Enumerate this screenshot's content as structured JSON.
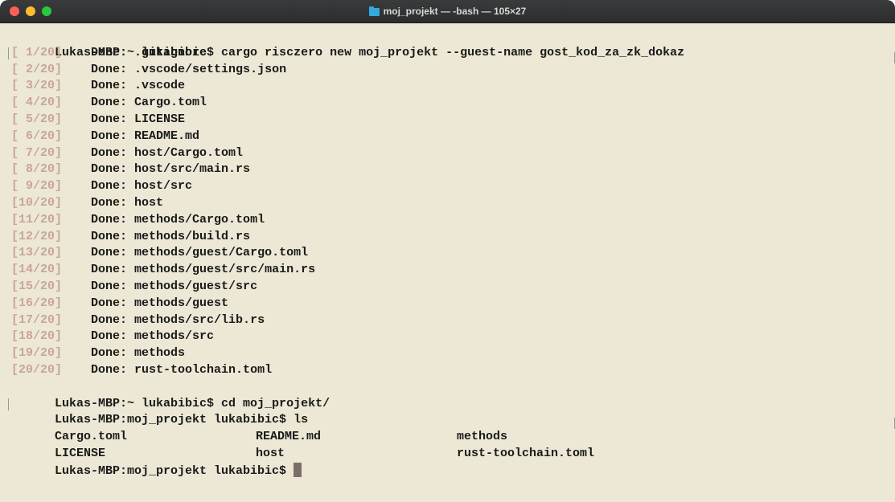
{
  "window": {
    "title": "moj_projekt — -bash — 105×27",
    "colors": {
      "background": "#ece8d5",
      "progress": "#c9a59a",
      "text": "#1a1a1a"
    }
  },
  "terminal": {
    "command1": "Lukas-MBP:~ lukabibic$ cargo risczero new moj_projekt --guest-name gost_kod_za_zk_dokaz",
    "progress": [
      {
        "counter": "[ 1/20]",
        "text": "Done: .gitignore"
      },
      {
        "counter": "[ 2/20]",
        "text": "Done: .vscode/settings.json"
      },
      {
        "counter": "[ 3/20]",
        "text": "Done: .vscode"
      },
      {
        "counter": "[ 4/20]",
        "text": "Done: Cargo.toml"
      },
      {
        "counter": "[ 5/20]",
        "text": "Done: LICENSE"
      },
      {
        "counter": "[ 6/20]",
        "text": "Done: README.md"
      },
      {
        "counter": "[ 7/20]",
        "text": "Done: host/Cargo.toml"
      },
      {
        "counter": "[ 8/20]",
        "text": "Done: host/src/main.rs"
      },
      {
        "counter": "[ 9/20]",
        "text": "Done: host/src"
      },
      {
        "counter": "[10/20]",
        "text": "Done: host"
      },
      {
        "counter": "[11/20]",
        "text": "Done: methods/Cargo.toml"
      },
      {
        "counter": "[12/20]",
        "text": "Done: methods/build.rs"
      },
      {
        "counter": "[13/20]",
        "text": "Done: methods/guest/Cargo.toml"
      },
      {
        "counter": "[14/20]",
        "text": "Done: methods/guest/src/main.rs"
      },
      {
        "counter": "[15/20]",
        "text": "Done: methods/guest/src"
      },
      {
        "counter": "[16/20]",
        "text": "Done: methods/guest"
      },
      {
        "counter": "[17/20]",
        "text": "Done: methods/src/lib.rs"
      },
      {
        "counter": "[18/20]",
        "text": "Done: methods/src"
      },
      {
        "counter": "[19/20]",
        "text": "Done: methods"
      },
      {
        "counter": "[20/20]",
        "text": "Done: rust-toolchain.toml"
      }
    ],
    "command2": "Lukas-MBP:~ lukabibic$ cd moj_projekt/",
    "command3": "Lukas-MBP:moj_projekt lukabibic$ ls",
    "ls_rows": [
      [
        "Cargo.toml",
        "README.md",
        "methods"
      ],
      [
        "LICENSE",
        "host",
        "rust-toolchain.toml"
      ]
    ],
    "prompt": "Lukas-MBP:moj_projekt lukabibic$ "
  }
}
